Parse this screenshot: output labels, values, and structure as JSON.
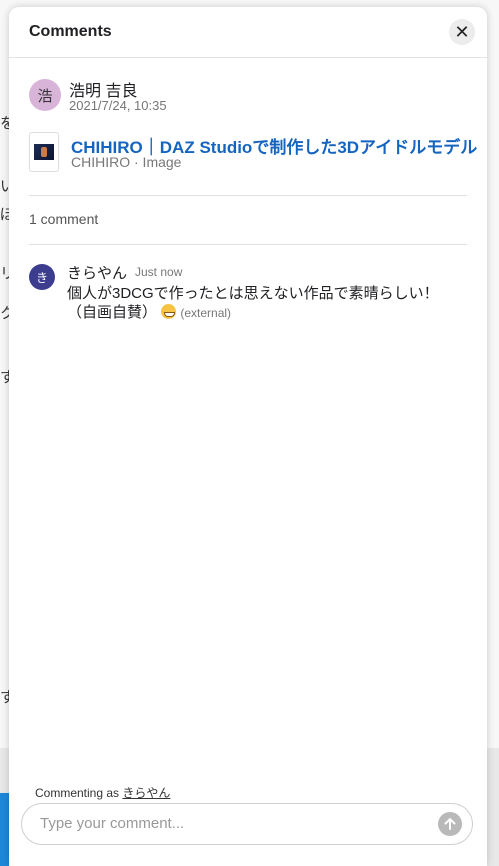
{
  "background": {
    "glyphs": [
      "を",
      "い",
      "ぼ",
      "リ",
      "ク",
      "す",
      "す"
    ]
  },
  "panel": {
    "title": "Comments",
    "close_icon": "close-icon"
  },
  "post": {
    "avatar_initial": "浩",
    "author": "浩明 吉良",
    "date": "2021/7/24, 10:35"
  },
  "link_card": {
    "title": "CHIHIRO｜DAZ Studioで制作した3Dアイドルモデル",
    "subtitle": "CHIHIRO · Image"
  },
  "comments_count": "1 comment",
  "comments": [
    {
      "avatar_initial": "き",
      "author": "きらやん",
      "time": "Just now",
      "body": "個人が3DCGで作ったとは思えない作品で素晴らしい！（自画自賛）",
      "emoji": "grinning-face",
      "external": "(external)"
    }
  ],
  "composer": {
    "commenting_as_label": "Commenting as",
    "commenting_as_user": "きらやん",
    "placeholder": "Type your comment..."
  },
  "colors": {
    "link": "#1565c0",
    "author_avatar": "#d9b4d9",
    "commenter_avatar": "#3d3d8f"
  }
}
